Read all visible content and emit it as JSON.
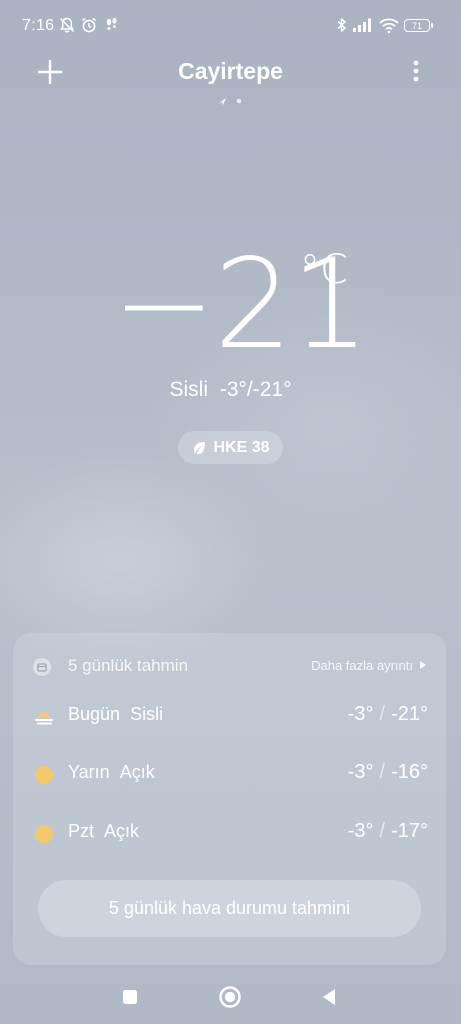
{
  "status_bar": {
    "time": "7:16",
    "battery": "71",
    "icons": [
      "bell-off-icon",
      "alarm-icon",
      "footsteps-icon",
      "bluetooth-icon",
      "signal-icon",
      "wifi-icon",
      "battery-icon"
    ]
  },
  "header": {
    "city": "Cayirtepe",
    "add_icon": "plus-icon",
    "menu_icon": "more-vert-icon"
  },
  "current": {
    "temperature": "−21",
    "unit": "°C",
    "condition": "Sisli",
    "range": "-3°/-21°",
    "aqi_label": "HKE 38"
  },
  "forecast": {
    "title": "5 günlük tahmin",
    "more_label": "Daha fazla ayrıntı",
    "days": [
      {
        "day": "Bugün",
        "condition": "Sisli",
        "high": "-3°",
        "low": "-21°",
        "icon": "fog-icon"
      },
      {
        "day": "Yarın",
        "condition": "Açık",
        "high": "-3°",
        "low": "-16°",
        "icon": "sun-icon"
      },
      {
        "day": "Pzt",
        "condition": "Açık",
        "high": "-3°",
        "low": "-17°",
        "icon": "sun-icon"
      }
    ],
    "separator": "/",
    "button_label": "5 günlük hava durumu tahmini"
  },
  "colors": {
    "sun": "#F6C86C",
    "background": "#B1BAC7"
  }
}
